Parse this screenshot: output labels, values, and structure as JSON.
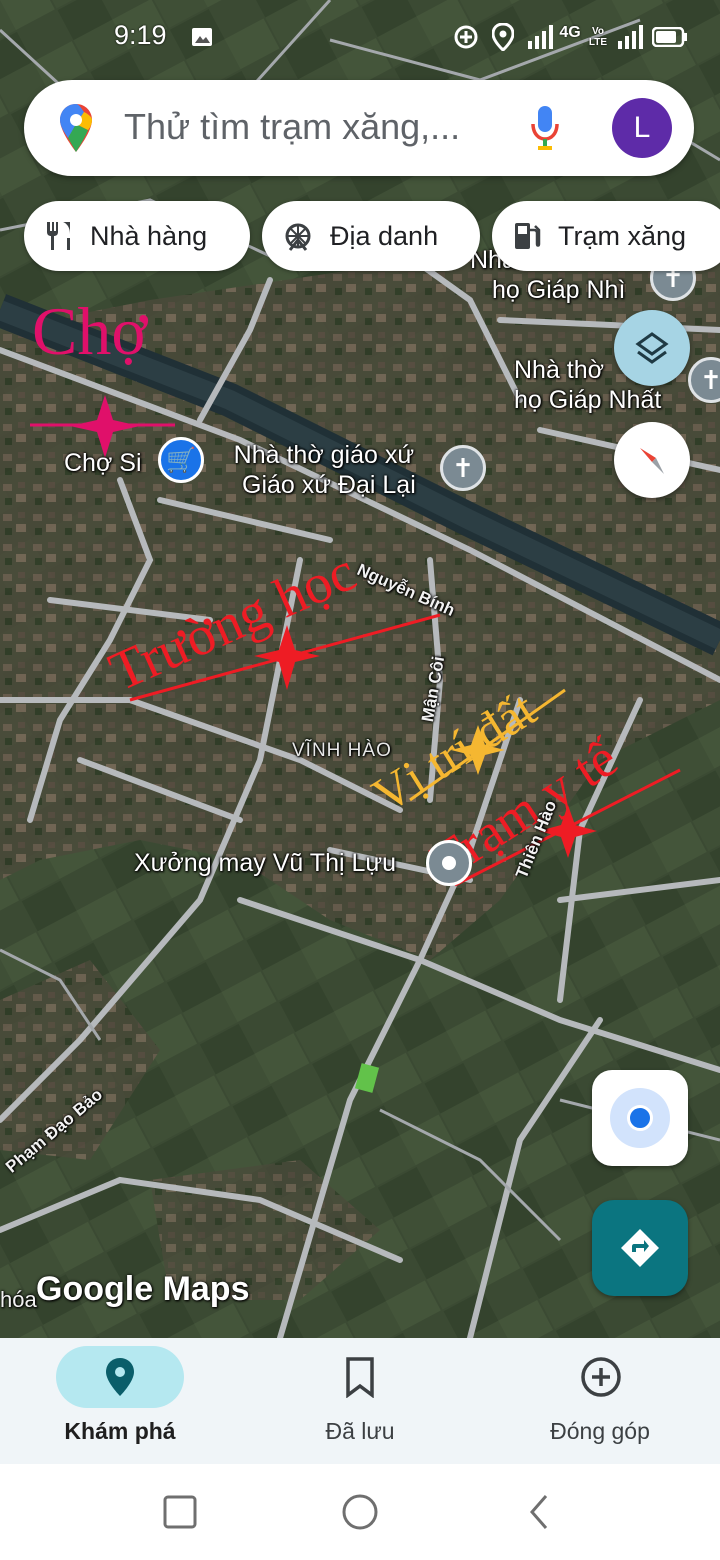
{
  "status_bar": {
    "time": "9:19",
    "network_1": "4G",
    "network_2": "Vo LTE"
  },
  "search": {
    "placeholder": "Thử tìm trạm xăng,...",
    "avatar_letter": "L"
  },
  "chips": [
    {
      "label": "Nhà hàng",
      "icon": "fork-knife-icon"
    },
    {
      "label": "Địa danh",
      "icon": "landmark-icon"
    },
    {
      "label": "Trạm xăng",
      "icon": "gas-station-icon"
    }
  ],
  "map": {
    "pois": {
      "cho_si": "Chợ Si",
      "nha_tho_giao_xu": "Nhà thờ giáo xứ",
      "giao_xu_dai_lai": "Giáo xứ Đại Lại",
      "nha_tho_giap_nhi_1": "Nhà",
      "nha_tho_giap_nhi_2": "họ Giáp Nhì",
      "nha_tho_giap_nhat_1": "Nhà thờ",
      "nha_tho_giap_nhat_2": "họ Giáp Nhất",
      "xuong_may": "Xưởng may Vũ Thị Lựu"
    },
    "roads": {
      "nguyen_binh": "Nguyễn Bính",
      "man_coi": "Mận Côi",
      "thien_hao": "Thiên Hào",
      "pham_dao_bao": "Phạm Đạo Bảo",
      "hao": "Hào",
      "hoa": "hóa"
    },
    "village": "VĨNH HÀO",
    "annotations": {
      "cho": "Chợ",
      "truong_hoc": "Trường học",
      "vi_tri_dat": "Vị trí đất",
      "tram_y_te": "Trạm y tế"
    },
    "colors": {
      "cho": "#e0106a",
      "truong_hoc": "#ee1c24",
      "vi_tri_dat": "#f5b731",
      "tram_y_te": "#ee1c24"
    },
    "logo": {
      "google": "Google",
      "maps": "Maps"
    }
  },
  "bottom_nav": [
    {
      "label": "Khám phá",
      "icon": "explore-pin-icon",
      "active": true
    },
    {
      "label": "Đã lưu",
      "icon": "bookmark-icon",
      "active": false
    },
    {
      "label": "Đóng góp",
      "icon": "add-circle-icon",
      "active": false
    }
  ]
}
